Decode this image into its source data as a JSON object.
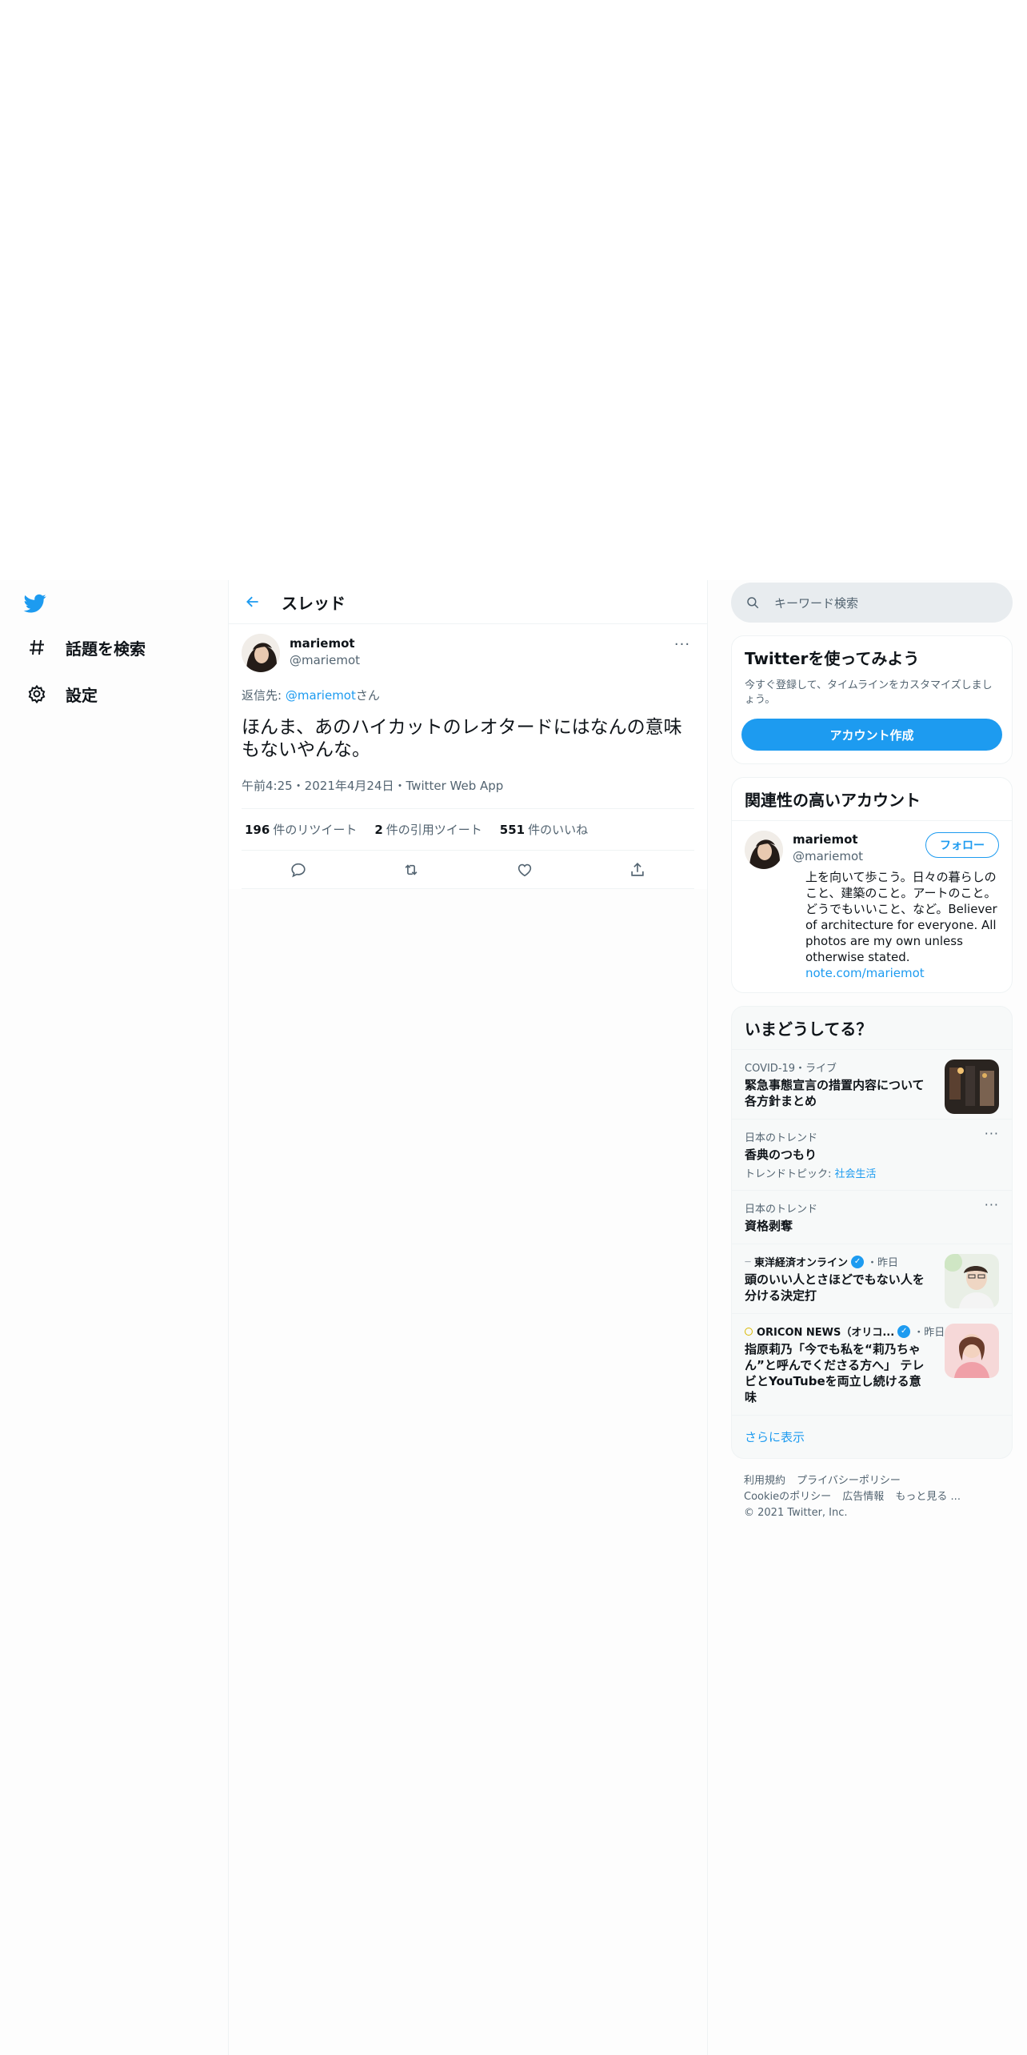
{
  "nav": {
    "items": [
      {
        "label": "話題を検索",
        "icon": "hashtag-icon"
      },
      {
        "label": "設定",
        "icon": "gear-icon"
      }
    ]
  },
  "header": {
    "title": "スレッド"
  },
  "tweet": {
    "author_name": "mariemot",
    "author_handle": "@mariemot",
    "more": "···",
    "reply_prefix": "返信先: ",
    "reply_handle": "@mariemot",
    "reply_suffix": "さん",
    "text": "ほんま、あのハイカットのレオタードにはなんの意味もないやんな。",
    "time": "午前4:25・2021年4月24日・",
    "source": "Twitter Web App",
    "stats": [
      {
        "count": "196",
        "label": "件のリツイート"
      },
      {
        "count": "2",
        "label": "件の引用ツイート"
      },
      {
        "count": "551",
        "label": "件のいいね"
      }
    ]
  },
  "search": {
    "placeholder": "キーワード検索"
  },
  "signup": {
    "title": "Twitterを使ってみよう",
    "subtitle": "今すぐ登録して、タイムラインをカスタマイズしましょう。",
    "button": "アカウント作成"
  },
  "related": {
    "title": "関連性の高いアカウント",
    "name": "mariemot",
    "handle": "@mariemot",
    "follow": "フォロー",
    "bio": "上を向いて歩こう。日々の暮らしのこと、建築のこと。アートのこと。どうでもいいこと、など。Believer of architecture for everyone. All photos are my own unless otherwise stated.",
    "url": "note.com/mariemot"
  },
  "trends": {
    "title": "いまどうしてる？",
    "items": [
      {
        "context": "COVID-19・ライブ",
        "title": "緊急事態宣言の措置内容について各方針まとめ",
        "sub": "",
        "topic": ""
      },
      {
        "context": "日本のトレンド",
        "title": "香典のつもり",
        "sub": "トレンドトピック: ",
        "topic": "社会生活"
      },
      {
        "context": "日本のトレンド",
        "title": "資格剥奪",
        "sub": "",
        "topic": ""
      },
      {
        "context": "東洋経済オンライン",
        "time": "・昨日",
        "title": "頭のいい人とさほどでもない人を分ける決定打",
        "sub": "",
        "topic": ""
      },
      {
        "context": "ORICON NEWS（オリコ...",
        "time": "・昨日",
        "title": "指原莉乃「今でも私を“莉乃ちゃん”と呼んでくださる方へ」 テレビとYouTubeを両立し続ける意味",
        "sub": "",
        "topic": ""
      }
    ],
    "show_more": "さらに表示"
  },
  "footer": {
    "links": [
      "利用規約",
      "プライバシーポリシー",
      "Cookieのポリシー",
      "広告情報",
      "もっと見る ..."
    ],
    "copyright": "© 2021 Twitter, Inc."
  },
  "colors": {
    "accent": "#1d9bf0",
    "text": "#0f1419",
    "muted": "#536471"
  }
}
